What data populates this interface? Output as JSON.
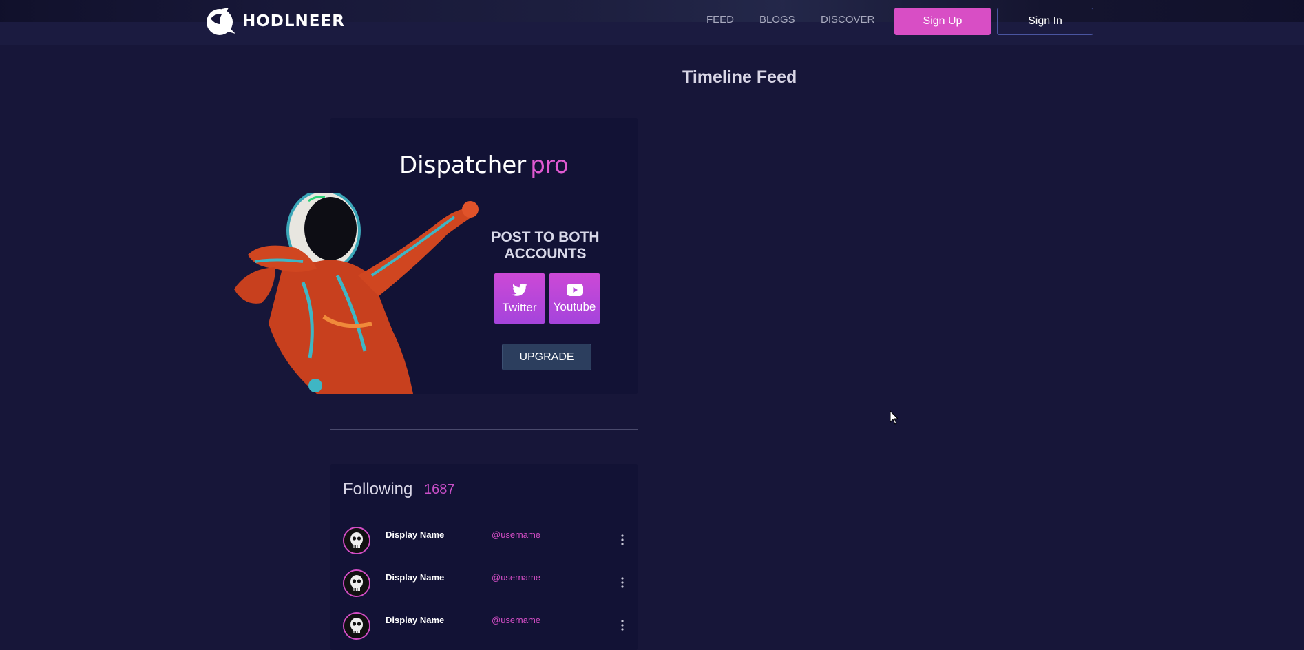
{
  "header": {
    "brand": "HODLNEER",
    "nav": [
      "FEED",
      "BLOGS",
      "DISCOVER"
    ],
    "signup_label": "Sign Up",
    "signin_label": "Sign In"
  },
  "main": {
    "timeline_title": "Timeline Feed"
  },
  "dispatcher": {
    "title": "Dispatcher",
    "title_accent": "pro",
    "post_both_line1": "POST TO BOTH",
    "post_both_line2": "ACCOUNTS",
    "twitter_label": "Twitter",
    "youtube_label": "Youtube",
    "upgrade_label": "UPGRADE"
  },
  "following": {
    "title": "Following",
    "count": "1687",
    "items": [
      {
        "display_name": "Display Name",
        "username": "@username"
      },
      {
        "display_name": "Display Name",
        "username": "@username"
      },
      {
        "display_name": "Display Name",
        "username": "@username"
      }
    ]
  },
  "colors": {
    "background": "#171639",
    "accent": "#d84ec5",
    "card": "#121235"
  },
  "icons": {
    "logo": "astronaut-helmet-icon",
    "twitter": "twitter-bird-icon",
    "youtube": "youtube-play-icon",
    "more": "vertical-dots-icon",
    "avatar": "skull-avatar-icon"
  }
}
